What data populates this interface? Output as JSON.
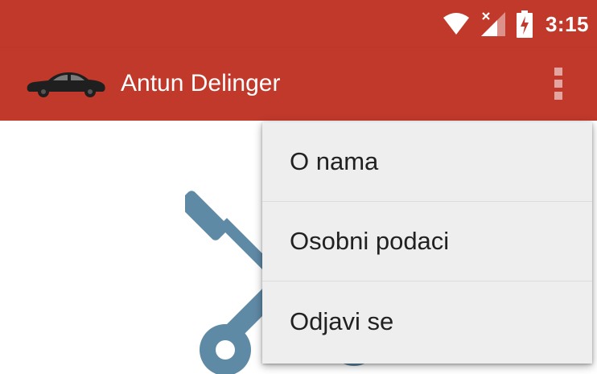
{
  "status_bar": {
    "time": "3:15",
    "icons": [
      "wifi-icon",
      "signal-no-sim-icon",
      "battery-charging-icon"
    ]
  },
  "app_bar": {
    "title": "Antun Delinger",
    "logo_icon": "car-icon",
    "overflow_icon": "more-vert-icon"
  },
  "menu": {
    "items": [
      {
        "label": "O nama"
      },
      {
        "label": "Osobni podaci"
      },
      {
        "label": "Odjavi se"
      }
    ]
  },
  "colors": {
    "primary": "#c0392b",
    "menu_background": "#eeeeee",
    "illustration": "#5f8aa6"
  }
}
